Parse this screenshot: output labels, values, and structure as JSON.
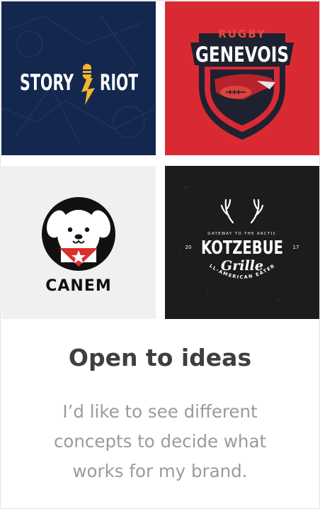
{
  "gallery": {
    "tiles": [
      {
        "brand_left": "STORY",
        "brand_right": "RIOT",
        "colors": {
          "bg": "#14284f",
          "text": "#ffffff",
          "accent": "#f2b52c"
        }
      },
      {
        "top_word": "RUGBY",
        "brand": "GENEVOIS",
        "colors": {
          "bg": "#d92a34",
          "shield": "#1d2130",
          "accent": "#d9443c"
        }
      },
      {
        "brand": "CANEM",
        "colors": {
          "bg": "#f1f0ee",
          "ink": "#111111",
          "scarf": "#d7312d"
        }
      },
      {
        "tagline": "GATEWAY TO THE ARCTIC",
        "brand": "KOTZEBUE",
        "script": "Grille",
        "year_left": "20",
        "year_right": "17",
        "sub": "ALL-AMERICAN EATERY",
        "colors": {
          "bg": "#1c1c1c",
          "text": "#ffffff"
        }
      }
    ]
  },
  "caption": {
    "title": "Open to ideas",
    "description": "I’d like to see different concepts to decide what works for my brand."
  }
}
